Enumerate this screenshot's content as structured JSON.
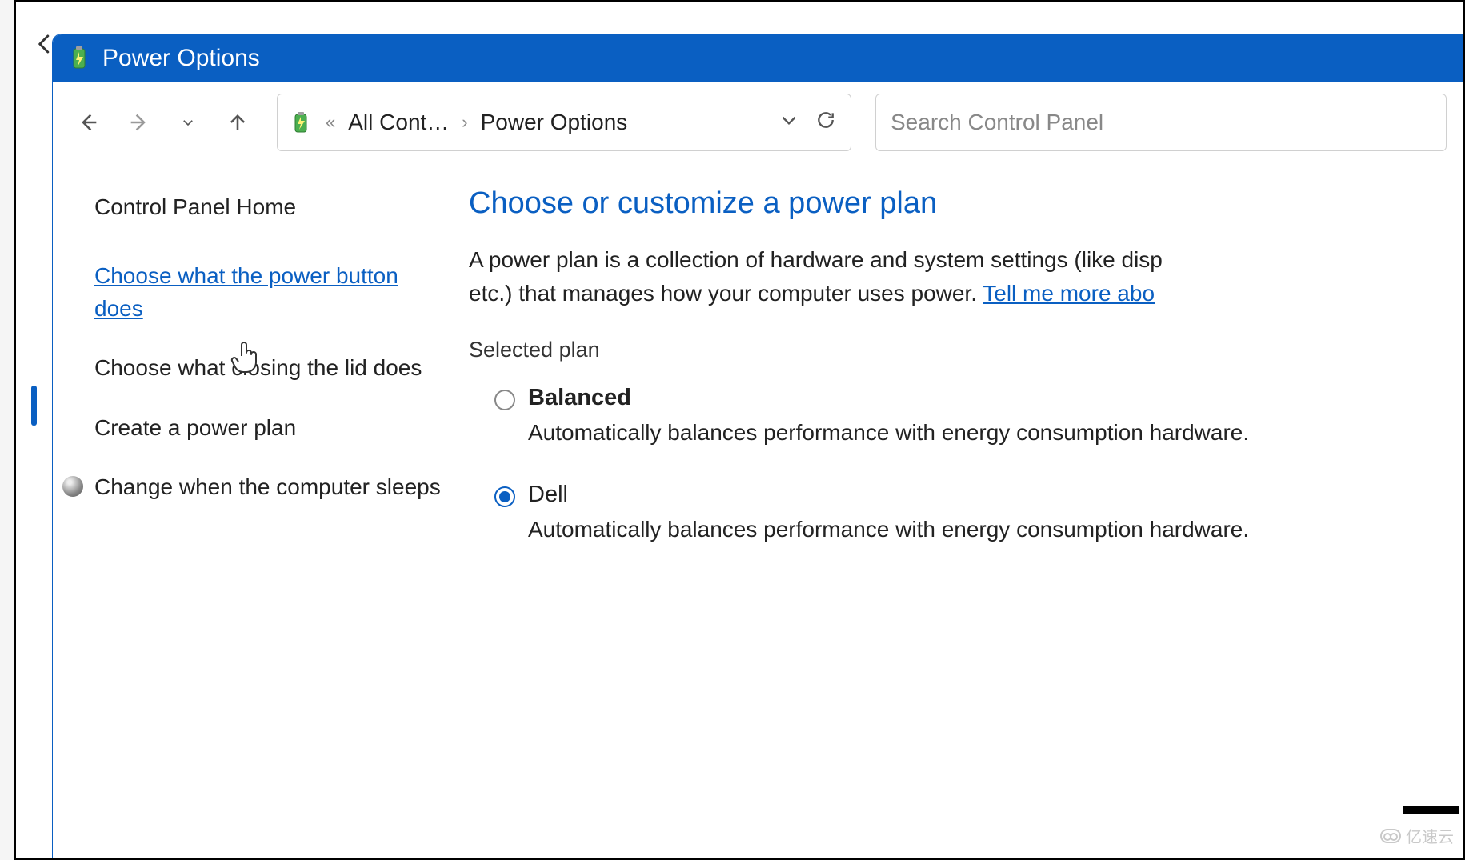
{
  "window": {
    "title": "Power Options"
  },
  "breadcrumb": {
    "root": "All Cont…",
    "current": "Power Options"
  },
  "search": {
    "placeholder": "Search Control Panel"
  },
  "sidebar": {
    "home": "Control Panel Home",
    "links": [
      "Choose what the power button does",
      "Choose what closing the lid does",
      "Create a power plan",
      "Change when the computer sleeps"
    ]
  },
  "main": {
    "heading": "Choose or customize a power plan",
    "description_part1": "A power plan is a collection of hardware and system settings (like disp",
    "description_part2": "etc.) that manages how your computer uses power. ",
    "description_link": "Tell me more abo",
    "section_label": "Selected plan",
    "plans": [
      {
        "name": "Balanced",
        "selected": false,
        "bold": true,
        "desc": "Automatically balances performance with energy consumption hardware."
      },
      {
        "name": "Dell",
        "selected": true,
        "bold": false,
        "desc": "Automatically balances performance with energy consumption hardware."
      }
    ]
  },
  "watermark": "亿速云"
}
